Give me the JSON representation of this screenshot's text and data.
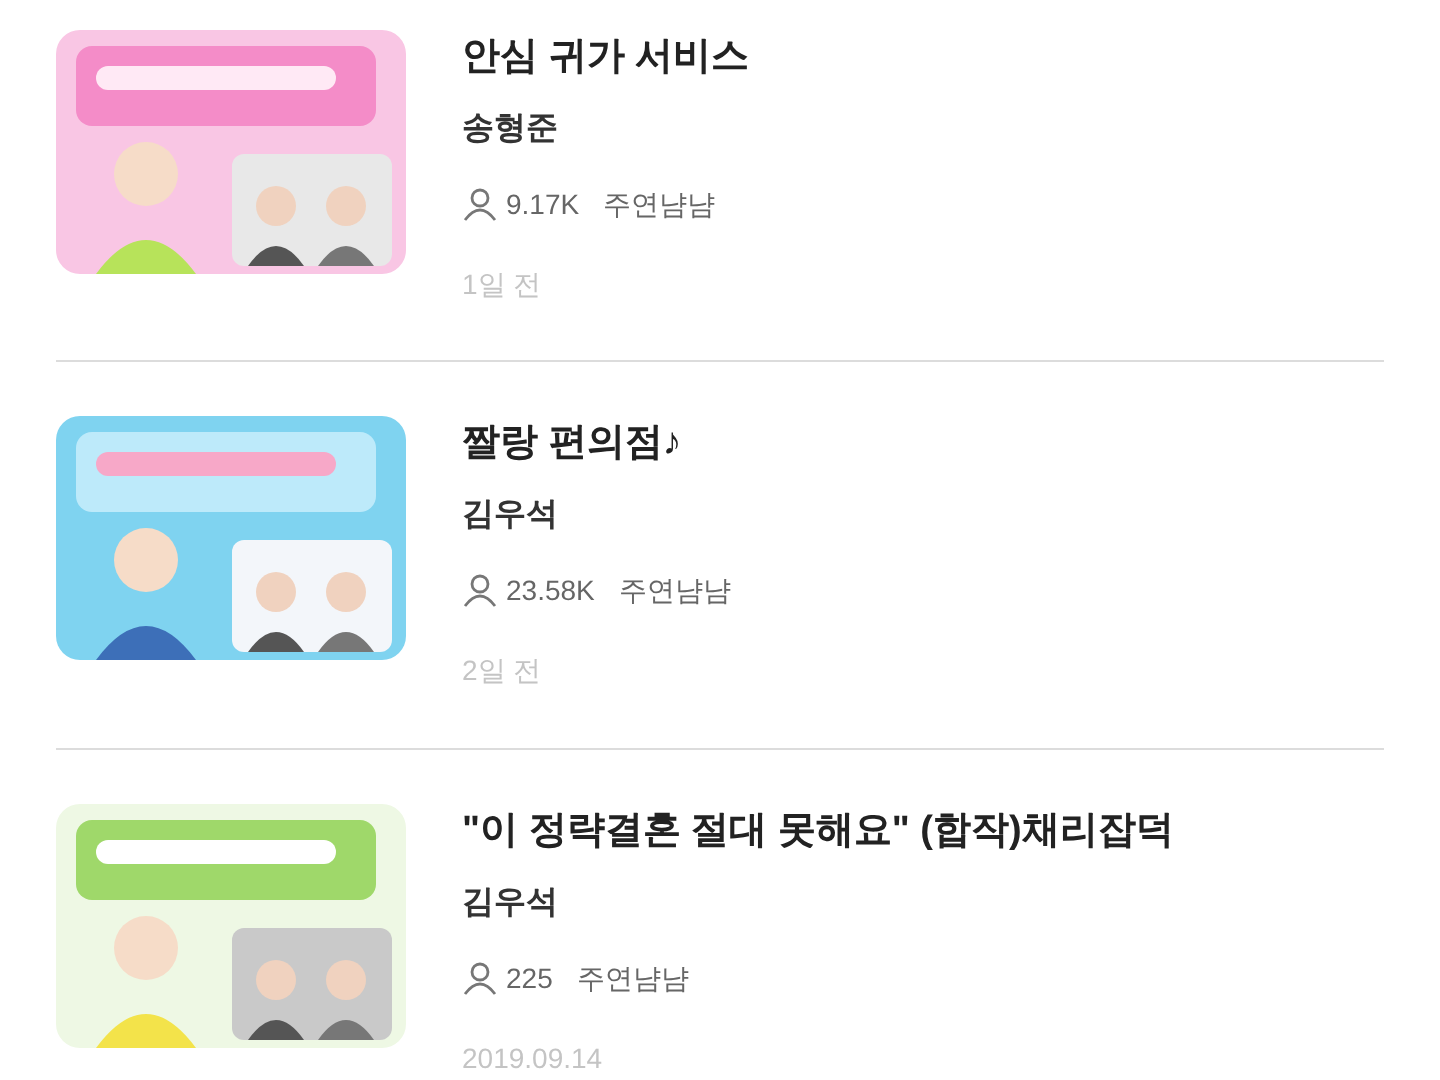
{
  "items": [
    {
      "title": "안심 귀가 서비스",
      "author": "송형준",
      "views": "9.17K",
      "channel": "주연냠냠",
      "date": "1일 전"
    },
    {
      "title": "짤랑 편의점♪",
      "author": "김우석",
      "views": "23.58K",
      "channel": "주연냠냠",
      "date": "2일 전"
    },
    {
      "title": "\"이 정략결혼 절대 못해요\" (합작)채리잡덕",
      "author": "김우석",
      "views": "225",
      "channel": "주연냠냠",
      "date": "2019.09.14"
    }
  ]
}
